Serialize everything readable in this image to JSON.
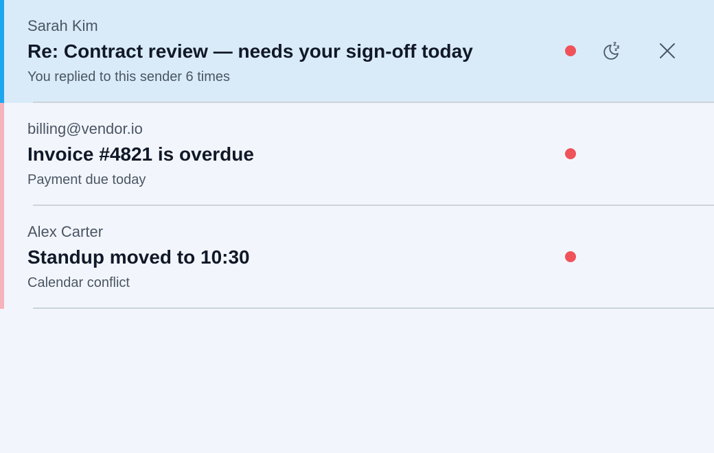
{
  "colors": {
    "background": "#f2f6fc",
    "selected_background": "#d9ebf9",
    "selected_stripe": "#1ea7ef",
    "priority_stripe": "#f7b3bb",
    "unread_dot": "#f0525a",
    "divider": "#cdd3db"
  },
  "messages": [
    {
      "sender": "Sarah Kim",
      "subject": "Re: Contract review — needs your sign-off today",
      "reason": "You replied to this sender 6 times",
      "unread": true,
      "selected": true,
      "actions": [
        "snooze-icon",
        "close-icon"
      ]
    },
    {
      "sender": "billing@vendor.io",
      "subject": "Invoice #4821 is overdue",
      "reason": "Payment due today",
      "unread": true,
      "selected": false
    },
    {
      "sender": "Alex Carter",
      "subject": "Standup moved to 10:30",
      "reason": "Calendar conflict",
      "unread": true,
      "selected": false
    }
  ]
}
